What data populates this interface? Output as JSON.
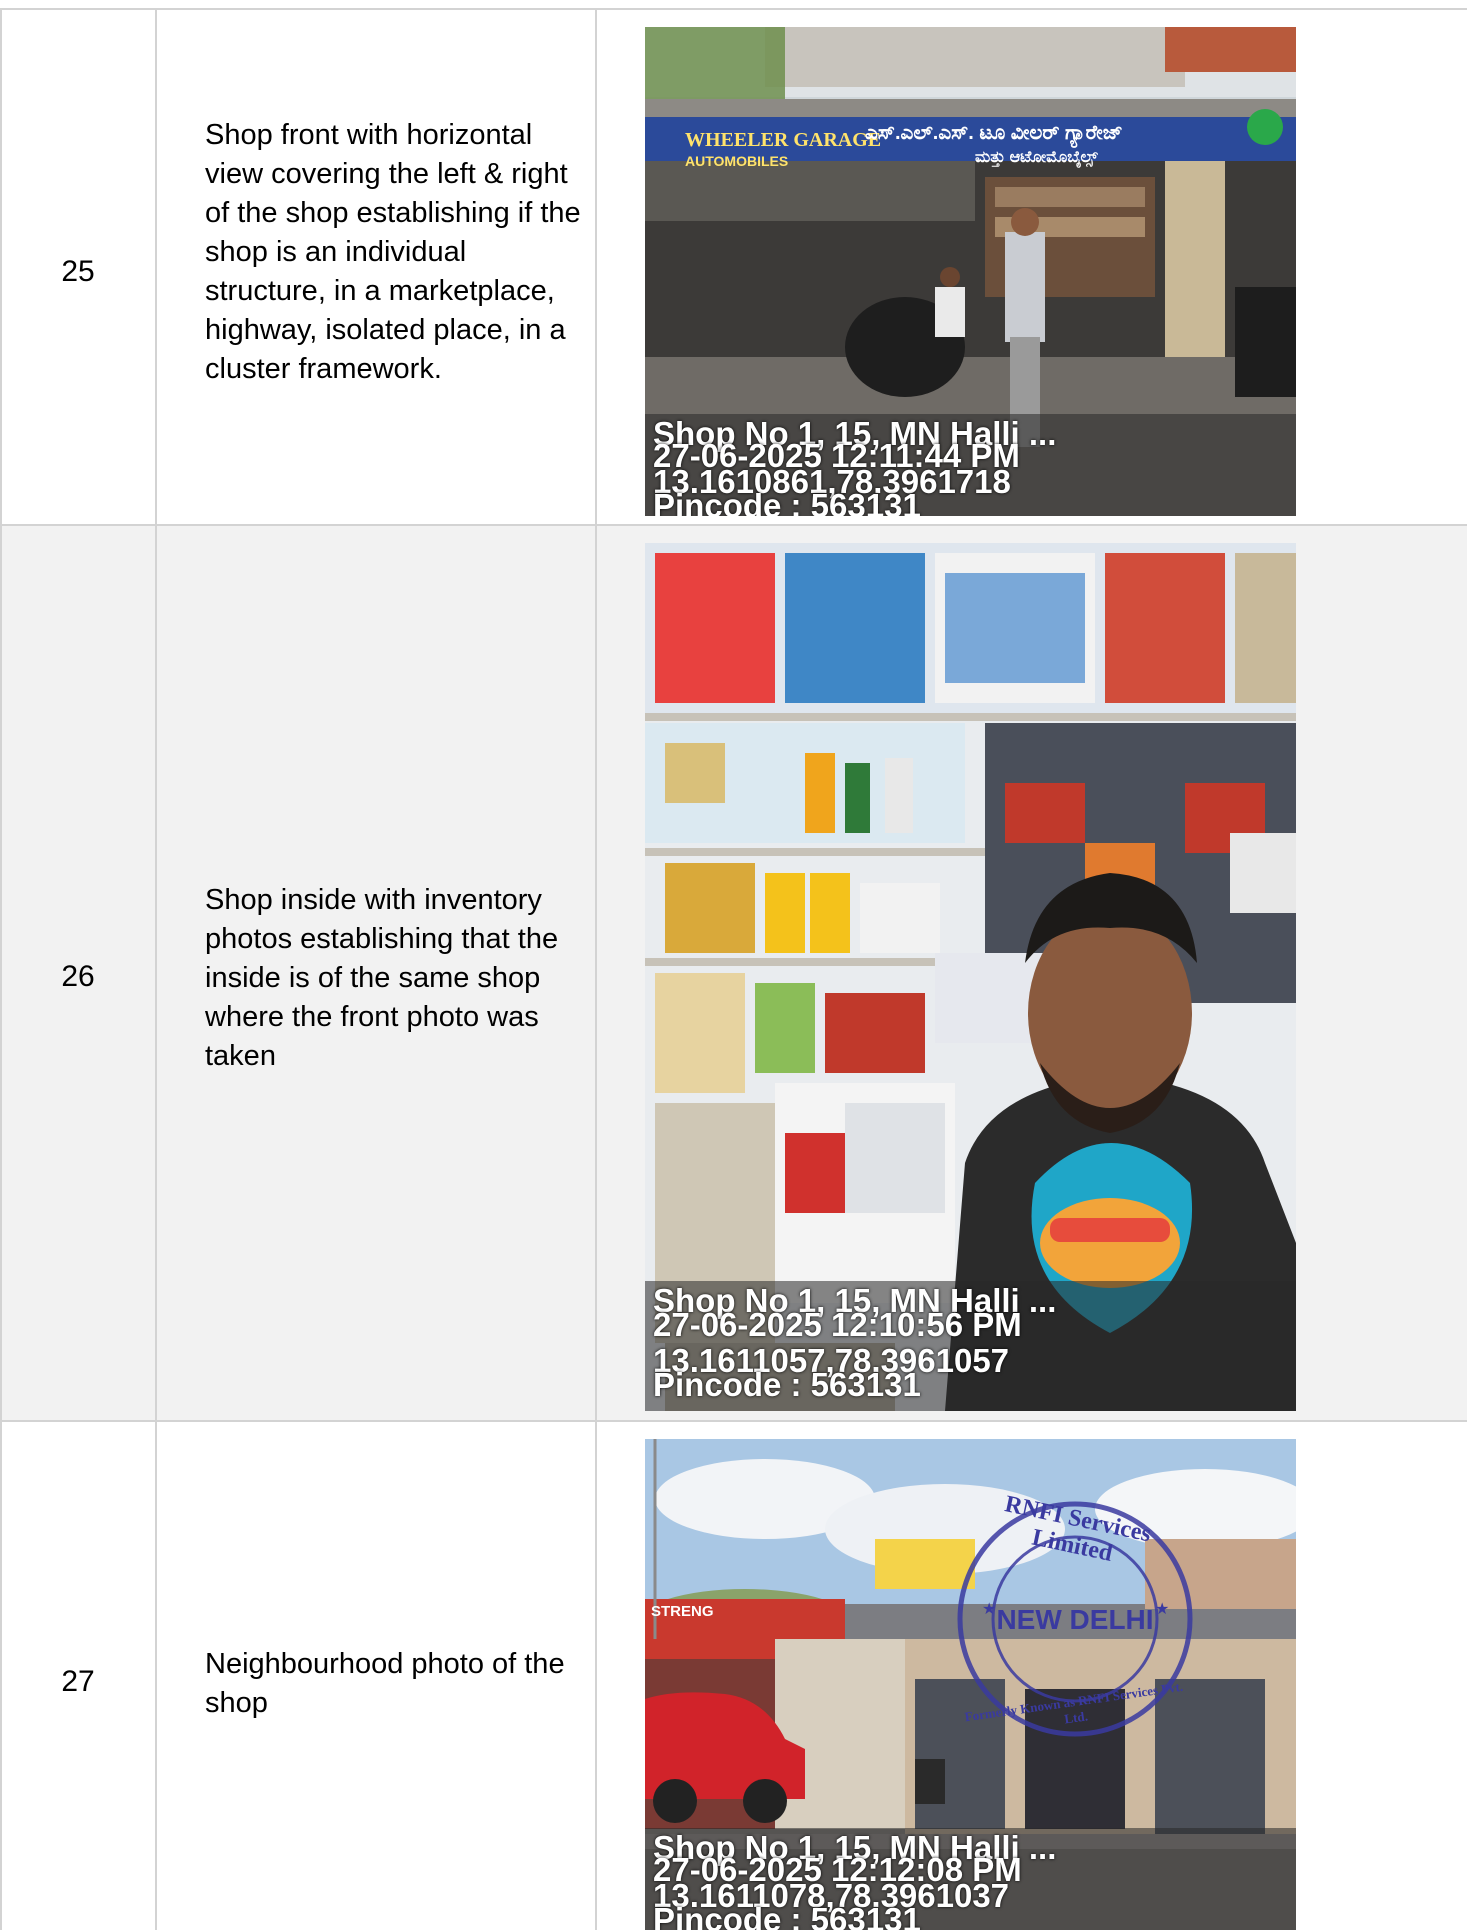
{
  "rows": [
    {
      "number": "25",
      "description": "Shop front with horizontal view covering the left & right of the shop establishing if the shop is an individual structure, in a marketplace, highway, isolated place, in a cluster framework.",
      "photo": {
        "sign_left": "WHEELER GARAGE",
        "sign_left2": "AUTOMOBILES",
        "sign_kannada": "ಎಸ್.ಎಲ್.ಎಸ್. ಟೂ ವೀಲರ್ ಗ್ಯಾರೇಜ್",
        "sign_kannada2": "ಮತ್ತು ಆಟೋಮೊಬೈಲ್ಸ್",
        "stamp": [
          "Shop No 1, 15, MN Halli ...",
          "27-06-2025 12:11:44 PM",
          "13.1610861,78.3961718",
          "Pincode : 563131"
        ]
      }
    },
    {
      "number": "26",
      "description": "Shop inside with inventory photos establishing that the inside is of the same shop where the front photo was taken",
      "photo": {
        "stamp": [
          "Shop No 1, 15, MN Halli ...",
          "27-06-2025 12:10:56 PM",
          "13.1611057,78.3961057",
          "Pincode : 563131"
        ]
      }
    },
    {
      "number": "27",
      "description": "Neighbourhood photo of the shop",
      "photo": {
        "wall_text": "STRENG",
        "seal_top": "RNFI Services Limited",
        "seal_center": "NEW DELHI",
        "seal_bottom": "Formerly Known as RNFI Services Pvt. Ltd.",
        "stamp": [
          "Shop No 1, 15, MN Halli ...",
          "27-06-2025 12:12:08 PM",
          "13.1611078,78.3961037",
          "Pincode : 563131"
        ]
      }
    }
  ],
  "colors": {
    "odd_row_bg": "#ffffff",
    "even_row_bg": "#f2f2f2",
    "grid_line": "#d3d3d3",
    "seal_blue": "#3a3aa0"
  }
}
